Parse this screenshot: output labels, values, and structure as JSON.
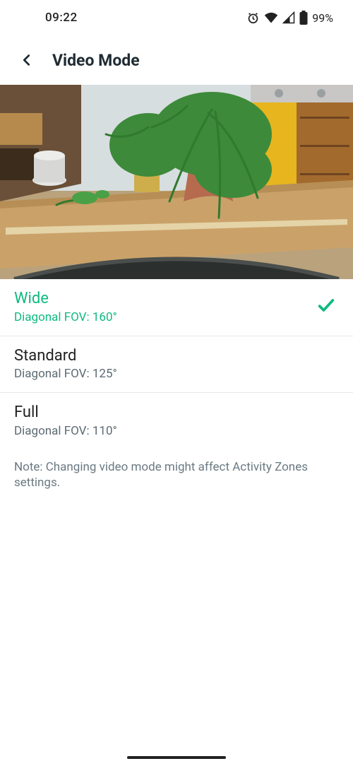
{
  "status": {
    "time": "09:22",
    "battery": "99%"
  },
  "header": {
    "title": "Video Mode"
  },
  "options": [
    {
      "label": "Wide",
      "sub": "Diagonal FOV: 160°",
      "selected": true
    },
    {
      "label": "Standard",
      "sub": "Diagonal FOV: 125°",
      "selected": false
    },
    {
      "label": "Full",
      "sub": "Diagonal FOV: 110°",
      "selected": false
    }
  ],
  "note": "Note: Changing video mode might affect Activity Zones settings."
}
